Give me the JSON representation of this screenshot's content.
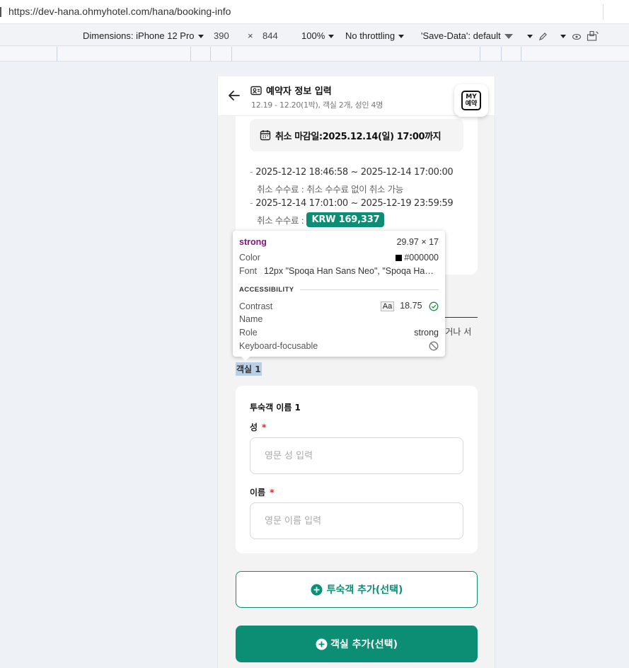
{
  "browser": {
    "url_prefix": "https://",
    "url_host": "dev-hana.ohmyhotel.com",
    "url_path": "/hana/booking-info"
  },
  "devtools": {
    "dimensions_label": "Dimensions: iPhone 12 Pro",
    "width": "390",
    "times": "×",
    "height": "844",
    "zoom": "100%",
    "throttling": "No throttling",
    "save_data": "'Save-Data': default"
  },
  "header": {
    "title": "예약자 정보 입력",
    "subtitle": "12.19 - 12.20(1박), 객실 2개, 성인 4명",
    "my_res_line1": "MY",
    "my_res_line2": "예약"
  },
  "cancel": {
    "deadline": "취소 마감일:2025.12.14(일) 17:00까지",
    "policies": [
      {
        "range": "2025-12-12 18:46:58 ~ 2025-12-14 17:00:00",
        "fee_label": "취소 수수료 :",
        "fee_text": "취소 수수료 없이 취소 가능"
      },
      {
        "range": "2025-12-14 17:01:00 ~ 2025-12-19 23:59:59",
        "fee_label": "취소 수수료 :",
        "fee_badge": "KRW 169,337"
      }
    ],
    "dash": "-"
  },
  "partial_text": "l거나 서",
  "room_label": "객실 1",
  "guest": {
    "title": "투숙객 이름 1",
    "last_name_label": "성",
    "last_name_placeholder": "영문 성 입력",
    "first_name_label": "이름",
    "first_name_placeholder": "영문 이름 입력",
    "required_mark": "*"
  },
  "buttons": {
    "add_guest": "투숙객 추가(선택)",
    "add_room": "객실 추가(선택)"
  },
  "inspector": {
    "tag": "strong",
    "size": "29.97 × 17",
    "color_label": "Color",
    "color_value": "#000000",
    "font_label": "Font",
    "font_value": "12px \"Spoqa Han Sans Neo\", \"Spoqa Ha…",
    "section": "ACCESSIBILITY",
    "contrast_label": "Contrast",
    "contrast_aa": "Aa",
    "contrast_value": "18.75",
    "name_label": "Name",
    "role_label": "Role",
    "role_value": "strong",
    "keyboard_label": "Keyboard-focusable"
  },
  "colors": {
    "brand_green": "#0b8e73",
    "required_red": "#e0212c",
    "inspector_tag": "#881280"
  }
}
